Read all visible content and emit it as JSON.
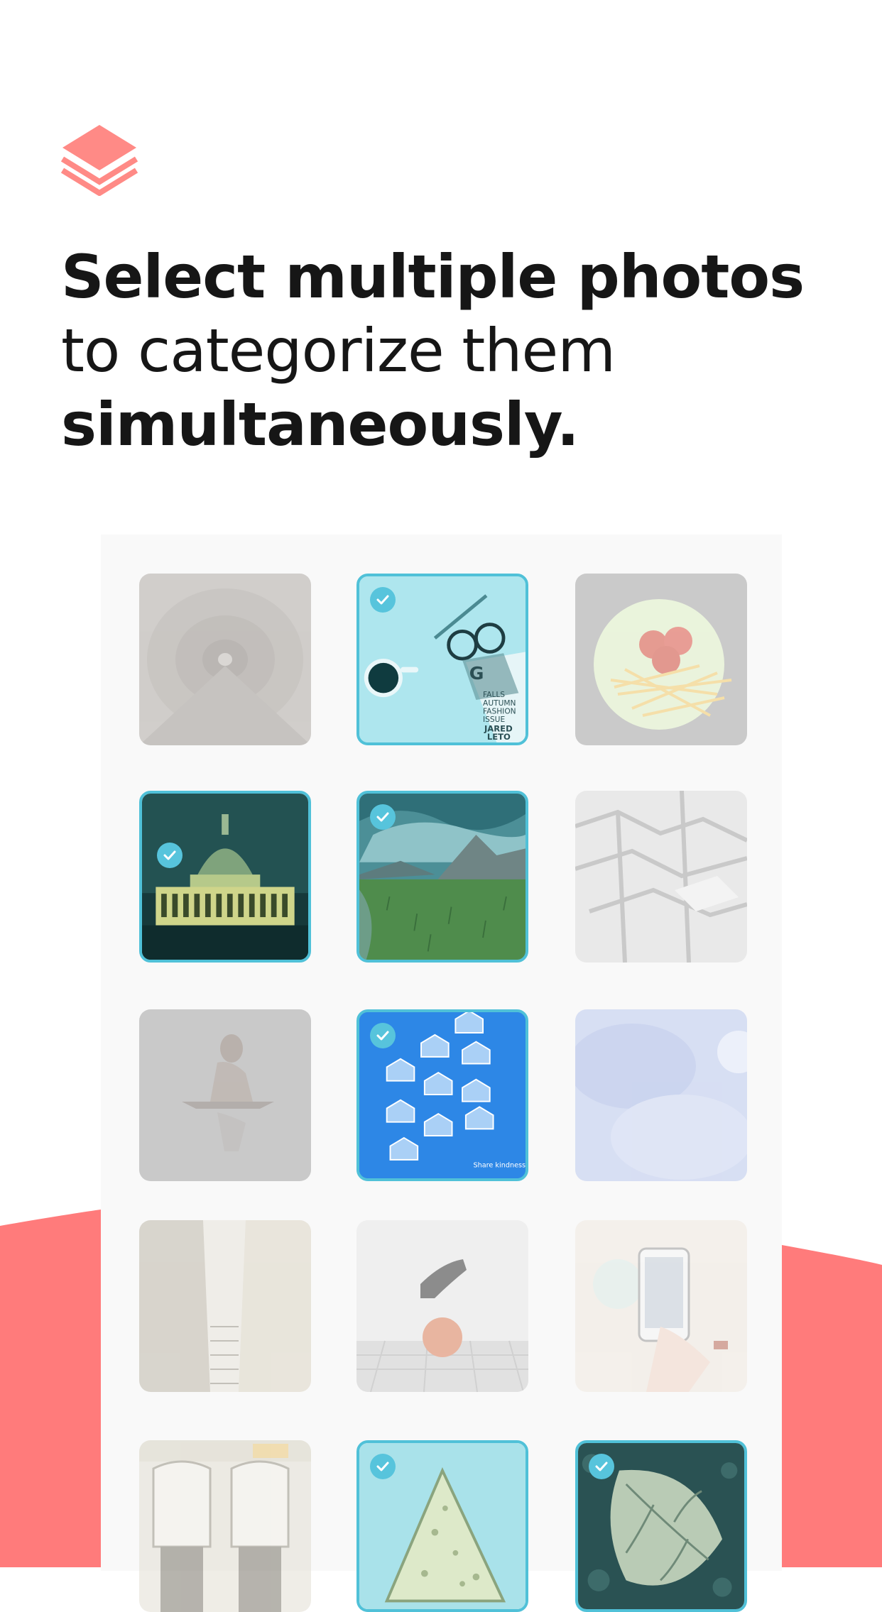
{
  "headline": {
    "line1": "Select multiple photos",
    "line2": "to categorize them",
    "line3": "simultaneously."
  },
  "colors": {
    "accent": "#ff7b7b",
    "selection": "#50c1d8",
    "panel": "#f9f9f9",
    "text": "#161616"
  },
  "logo": {
    "icon": "stacked-layers-icon"
  },
  "photo_grid": {
    "tiles": [
      {
        "subject": "tunnel",
        "selected": false
      },
      {
        "subject": "desk-coffee-glasses",
        "selected": true,
        "magazine_text": "G",
        "magazine_lines": [
          "FALLS",
          "AUTUMN",
          "FASHION",
          "ISSUE",
          "JARED",
          "LETO"
        ]
      },
      {
        "subject": "plate-tomatoes-fries",
        "selected": false
      },
      {
        "subject": "capitol-night",
        "selected": true
      },
      {
        "subject": "mountain-landscape",
        "selected": true
      },
      {
        "subject": "paving-tiles",
        "selected": false
      },
      {
        "subject": "woman-reflection",
        "selected": false
      },
      {
        "subject": "houses-kindness",
        "selected": true,
        "caption": "Share kindness."
      },
      {
        "subject": "blue-smoke",
        "selected": false
      },
      {
        "subject": "narrow-alley",
        "selected": false
      },
      {
        "subject": "sneaker-basketball",
        "selected": false
      },
      {
        "subject": "phone-hands",
        "selected": false
      },
      {
        "subject": "storefront",
        "selected": false
      },
      {
        "subject": "crepe",
        "selected": true
      },
      {
        "subject": "leaf",
        "selected": true
      }
    ]
  }
}
